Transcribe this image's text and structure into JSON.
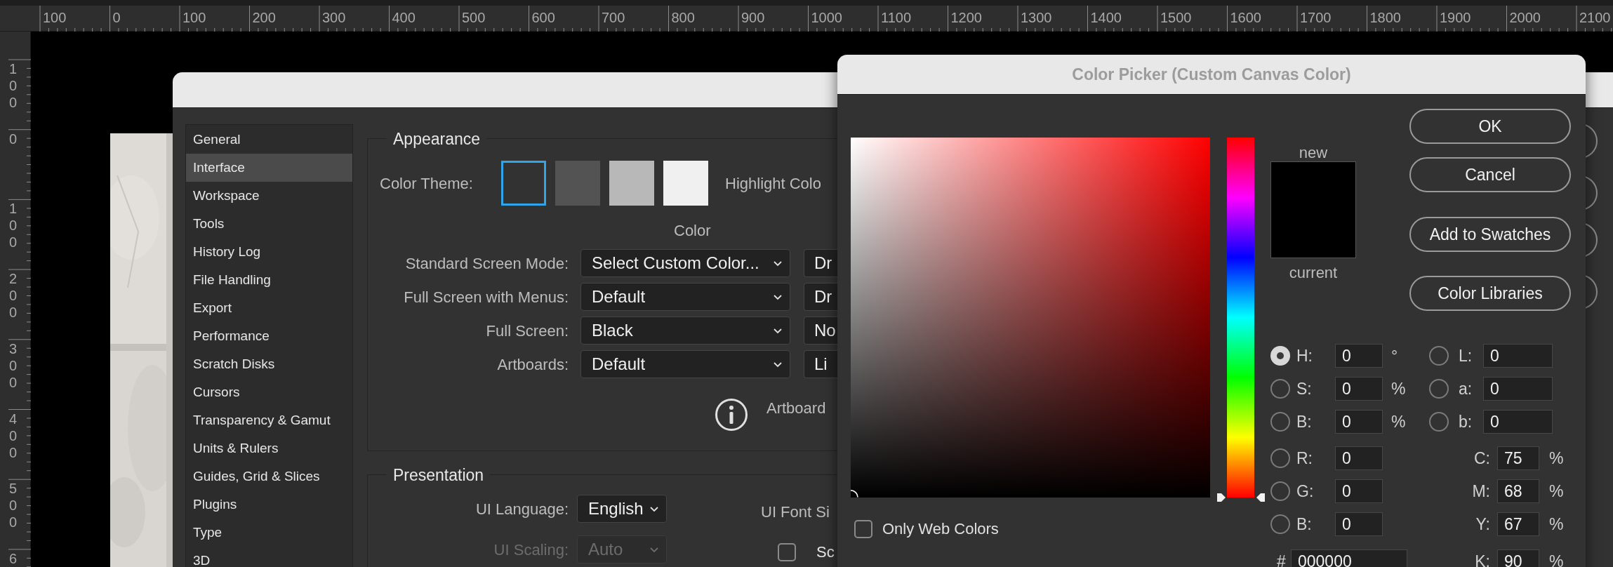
{
  "rulers": {
    "horizontal": [
      "100",
      "0",
      "100",
      "200",
      "300",
      "400",
      "500",
      "600",
      "700",
      "800",
      "900",
      "1000",
      "1100",
      "1200",
      "1300",
      "1400",
      "1500",
      "1600",
      "1700",
      "1800",
      "1900",
      "2000",
      "2100"
    ],
    "vertical": [
      "100",
      "0",
      "100",
      "200",
      "300",
      "400",
      "500",
      "6"
    ]
  },
  "preferences": {
    "sidebar": [
      {
        "label": "General",
        "selected": false
      },
      {
        "label": "Interface",
        "selected": true
      },
      {
        "label": "Workspace",
        "selected": false
      },
      {
        "label": "Tools",
        "selected": false
      },
      {
        "label": "History Log",
        "selected": false
      },
      {
        "label": "File Handling",
        "selected": false
      },
      {
        "label": "Export",
        "selected": false
      },
      {
        "label": "Performance",
        "selected": false
      },
      {
        "label": "Scratch Disks",
        "selected": false
      },
      {
        "label": "Cursors",
        "selected": false
      },
      {
        "label": "Transparency & Gamut",
        "selected": false
      },
      {
        "label": "Units & Rulers",
        "selected": false
      },
      {
        "label": "Guides, Grid & Slices",
        "selected": false
      },
      {
        "label": "Plugins",
        "selected": false
      },
      {
        "label": "Type",
        "selected": false
      },
      {
        "label": "3D",
        "selected": false
      }
    ],
    "appearance": {
      "title": "Appearance",
      "color_theme_label": "Color Theme:",
      "themes": [
        {
          "color": "#323232",
          "selected": true
        },
        {
          "color": "#535353",
          "selected": false
        },
        {
          "color": "#b8b8b8",
          "selected": false
        },
        {
          "color": "#f0f0f0",
          "selected": false
        }
      ],
      "highlight_label": "Highlight Colo",
      "color_heading": "Color",
      "rows": [
        {
          "label": "Standard Screen Mode:",
          "value": "Select Custom Color...",
          "second_value": "Dr"
        },
        {
          "label": "Full Screen with Menus:",
          "value": "Default",
          "second_value": "Dr"
        },
        {
          "label": "Full Screen:",
          "value": "Black",
          "second_value": "No"
        },
        {
          "label": "Artboards:",
          "value": "Default",
          "second_value": "Li"
        }
      ],
      "info_text": "Artboard"
    },
    "presentation": {
      "title": "Presentation",
      "language_label": "UI Language:",
      "language": "English",
      "scaling_label": "UI Scaling:",
      "scaling": "Auto",
      "scaling_disabled": true,
      "font_size_label": "UI Font Si",
      "option": {
        "label": "Sc",
        "checked": false
      }
    }
  },
  "color_picker": {
    "title": "Color Picker (Custom Canvas Color)",
    "buttons": [
      "OK",
      "Cancel",
      "Add to Swatches",
      "Color Libraries"
    ],
    "new_label": "new",
    "current_label": "current",
    "hue_slider": {
      "level": 0
    },
    "fields_left": [
      {
        "kind": "radio",
        "label": "H:",
        "value": "0",
        "unit": "°",
        "selected": true
      },
      {
        "kind": "radio",
        "label": "S:",
        "value": "0",
        "unit": "%",
        "selected": false
      },
      {
        "kind": "radio",
        "label": "B:",
        "value": "0",
        "unit": "%",
        "selected": false
      },
      {
        "kind": "radio",
        "label": "R:",
        "value": "0",
        "selected": false
      },
      {
        "kind": "radio",
        "label": "G:",
        "value": "0",
        "selected": false
      },
      {
        "kind": "radio",
        "label": "B:",
        "value": "0",
        "selected": false
      },
      {
        "kind": "hex",
        "label": "#",
        "value": "000000"
      }
    ],
    "fields_right": [
      {
        "kind": "radio",
        "label": "L:",
        "value": "0",
        "selected": false
      },
      {
        "kind": "radio",
        "label": "a:",
        "value": "0",
        "selected": false
      },
      {
        "kind": "radio",
        "label": "b:",
        "value": "0",
        "selected": false
      },
      {
        "kind": "plain",
        "label": "C:",
        "value": "75",
        "unit": "%"
      },
      {
        "kind": "plain",
        "label": "M:",
        "value": "68",
        "unit": "%"
      },
      {
        "kind": "plain",
        "label": "Y:",
        "value": "67",
        "unit": "%"
      },
      {
        "kind": "plain",
        "label": "K:",
        "value": "90",
        "unit": "%"
      }
    ],
    "only_web_colors": {
      "label": "Only Web Colors",
      "checked": false
    }
  }
}
